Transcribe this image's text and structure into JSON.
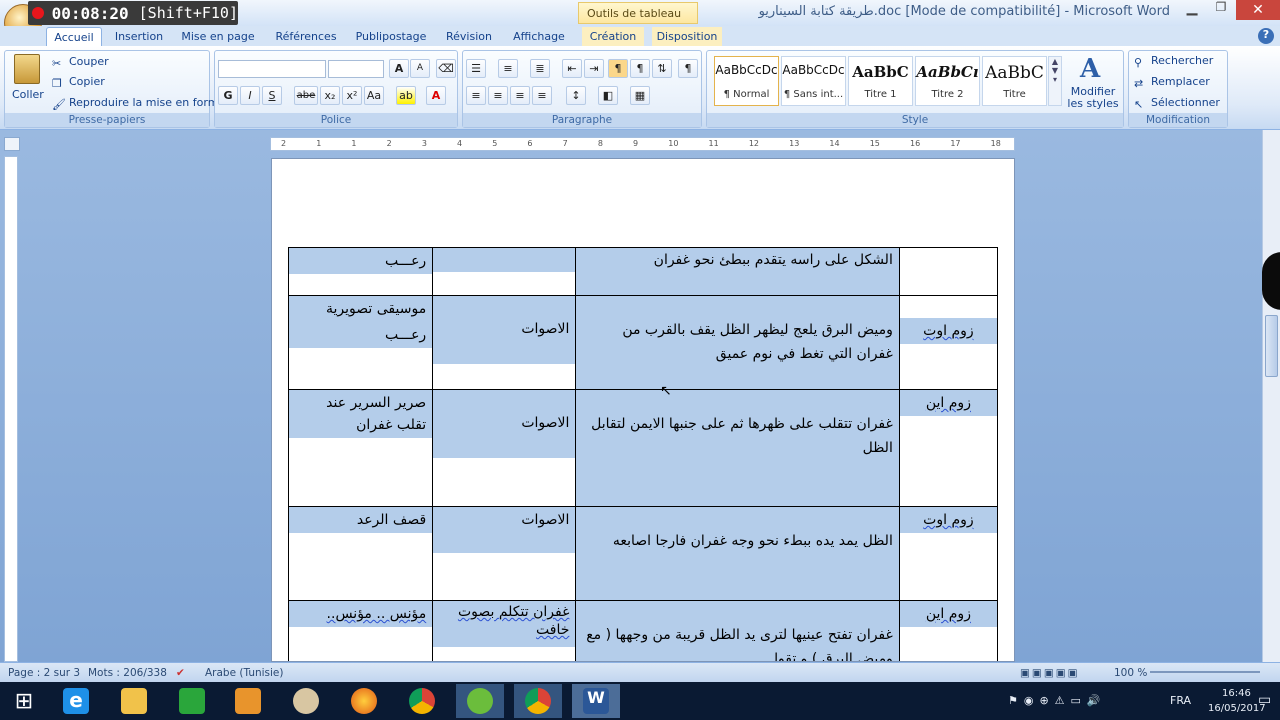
{
  "window": {
    "title": "طريقة كتابة السيناريو.doc [Mode de compatibilité] - Microsoft Word",
    "context_tab": "Outils de tableau",
    "recorder_time": "00:08:20",
    "recorder_hint": "[Shift+F10]"
  },
  "tabs": [
    "Accueil",
    "Insertion",
    "Mise en page",
    "Références",
    "Publipostage",
    "Révision",
    "Affichage",
    "Création",
    "Disposition"
  ],
  "ribbon": {
    "clipboard": {
      "label": "Presse-papiers",
      "paste": "Coller",
      "cut": "Couper",
      "copy": "Copier",
      "format_painter": "Reproduire la mise en forme"
    },
    "font": {
      "label": "Police",
      "font_name": "",
      "font_size": "",
      "bold": "G",
      "italic": "I",
      "underline": "S",
      "strike": "abe",
      "subscript": "x₂",
      "superscript": "x²",
      "case": "Aa",
      "grow": "A",
      "shrink": "A"
    },
    "paragraph": {
      "label": "Paragraphe"
    },
    "styles": {
      "label": "Style",
      "items": [
        {
          "preview": "AaBbCcDc",
          "name": "¶ Normal"
        },
        {
          "preview": "AaBbCcDc",
          "name": "¶ Sans int..."
        },
        {
          "preview": "AaBbC",
          "name": "Titre 1"
        },
        {
          "preview": "AaBbCı",
          "name": "Titre 2"
        },
        {
          "preview": "AaBbC",
          "name": "Titre"
        }
      ],
      "modify": "Modifier les styles"
    },
    "editing": {
      "label": "Modification",
      "find": "Rechercher",
      "replace": "Remplacer",
      "select": "Sélectionner"
    }
  },
  "ruler": {
    "ticks": [
      "2",
      "1",
      "1",
      "2",
      "3",
      "4",
      "5",
      "6",
      "7",
      "8",
      "9",
      "10",
      "11",
      "12",
      "13",
      "14",
      "15",
      "16",
      "17",
      "18"
    ]
  },
  "table": {
    "rows": [
      {
        "shot": "",
        "desc": "الشكل على راسه يتقدم ببطئ نحو غفران",
        "sound": "",
        "music": "رعـــب"
      },
      {
        "shot": "زوم اوت",
        "desc": "وميض البرق يلعج ليظهر الظل يقف بالقرب من غفران التي تغط في نوم عميق",
        "sound": "الاصوات",
        "music": "موسيقى تصويرية",
        "music2": "رعـــب"
      },
      {
        "shot": "زوم اين",
        "desc": "غفران تتقلب على ظهرها ثم على جنبها الايمن لتقابل الظل",
        "sound": "الاصوات",
        "music": "صرير السرير عند تقلب غفران"
      },
      {
        "shot": "زوم اوت",
        "desc": "الظل يمد يده ببطء نحو وجه غفران فارجا اصابعه",
        "sound": "الاصوات",
        "music": "قصف الرعد"
      },
      {
        "shot": "زوم اين",
        "desc": "غفران تفتح عينيها لترى يد الظل قريبة من وجهها ( مع وميض البرق ) و تقول",
        "sound": "غفران تتكلم بصوت خافت",
        "music": "مؤنس .. مؤنس.."
      }
    ]
  },
  "status": {
    "page": "Page : 2 sur 3",
    "words": "Mots : 206/338",
    "language": "Arabe (Tunisie)",
    "zoom": "100 %"
  },
  "tray": {
    "lang": "FRA",
    "time": "16:46",
    "date": "16/05/2017"
  }
}
